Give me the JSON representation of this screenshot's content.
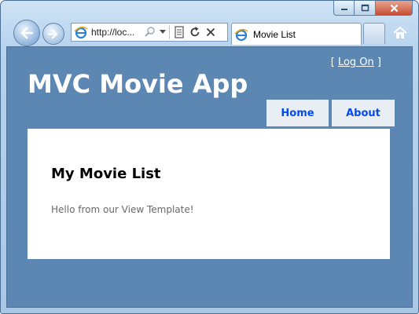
{
  "browser": {
    "address_url": "http://loc...",
    "tab_title": "Movie List"
  },
  "site": {
    "logon_open_bracket": "[",
    "logon_link": "Log On",
    "logon_close_bracket": "]",
    "title": "MVC Movie App",
    "menu": [
      {
        "label": "Home"
      },
      {
        "label": "About"
      }
    ]
  },
  "page": {
    "heading": "My Movie List",
    "message": "Hello from our View Template!"
  },
  "colors": {
    "page_background": "#5c87b2",
    "menu_text": "#034af3",
    "menu_background": "#e8eef4"
  }
}
